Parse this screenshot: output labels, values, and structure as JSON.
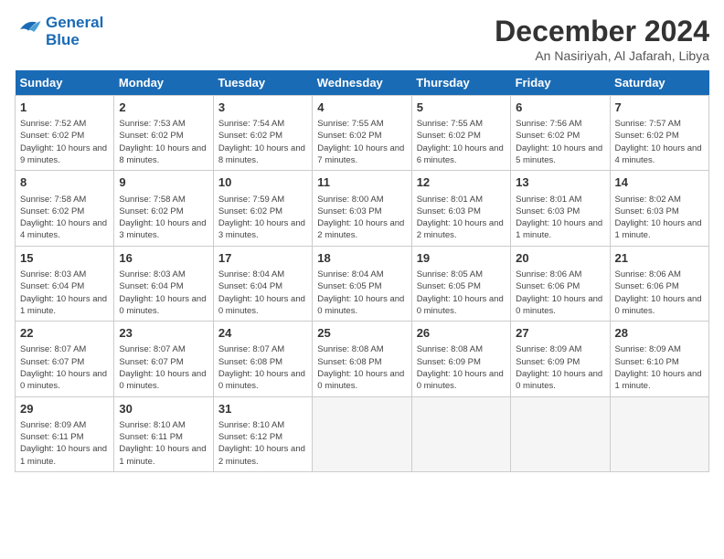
{
  "header": {
    "logo_line1": "General",
    "logo_line2": "Blue",
    "month_title": "December 2024",
    "subtitle": "An Nasiriyah, Al Jafarah, Libya"
  },
  "weekdays": [
    "Sunday",
    "Monday",
    "Tuesday",
    "Wednesday",
    "Thursday",
    "Friday",
    "Saturday"
  ],
  "weeks": [
    [
      {
        "day": 1,
        "sunrise": "7:52 AM",
        "sunset": "6:02 PM",
        "daylight": "10 hours and 9 minutes."
      },
      {
        "day": 2,
        "sunrise": "7:53 AM",
        "sunset": "6:02 PM",
        "daylight": "10 hours and 8 minutes."
      },
      {
        "day": 3,
        "sunrise": "7:54 AM",
        "sunset": "6:02 PM",
        "daylight": "10 hours and 8 minutes."
      },
      {
        "day": 4,
        "sunrise": "7:55 AM",
        "sunset": "6:02 PM",
        "daylight": "10 hours and 7 minutes."
      },
      {
        "day": 5,
        "sunrise": "7:55 AM",
        "sunset": "6:02 PM",
        "daylight": "10 hours and 6 minutes."
      },
      {
        "day": 6,
        "sunrise": "7:56 AM",
        "sunset": "6:02 PM",
        "daylight": "10 hours and 5 minutes."
      },
      {
        "day": 7,
        "sunrise": "7:57 AM",
        "sunset": "6:02 PM",
        "daylight": "10 hours and 4 minutes."
      }
    ],
    [
      {
        "day": 8,
        "sunrise": "7:58 AM",
        "sunset": "6:02 PM",
        "daylight": "10 hours and 4 minutes."
      },
      {
        "day": 9,
        "sunrise": "7:58 AM",
        "sunset": "6:02 PM",
        "daylight": "10 hours and 3 minutes."
      },
      {
        "day": 10,
        "sunrise": "7:59 AM",
        "sunset": "6:02 PM",
        "daylight": "10 hours and 3 minutes."
      },
      {
        "day": 11,
        "sunrise": "8:00 AM",
        "sunset": "6:03 PM",
        "daylight": "10 hours and 2 minutes."
      },
      {
        "day": 12,
        "sunrise": "8:01 AM",
        "sunset": "6:03 PM",
        "daylight": "10 hours and 2 minutes."
      },
      {
        "day": 13,
        "sunrise": "8:01 AM",
        "sunset": "6:03 PM",
        "daylight": "10 hours and 1 minute."
      },
      {
        "day": 14,
        "sunrise": "8:02 AM",
        "sunset": "6:03 PM",
        "daylight": "10 hours and 1 minute."
      }
    ],
    [
      {
        "day": 15,
        "sunrise": "8:03 AM",
        "sunset": "6:04 PM",
        "daylight": "10 hours and 1 minute."
      },
      {
        "day": 16,
        "sunrise": "8:03 AM",
        "sunset": "6:04 PM",
        "daylight": "10 hours and 0 minutes."
      },
      {
        "day": 17,
        "sunrise": "8:04 AM",
        "sunset": "6:04 PM",
        "daylight": "10 hours and 0 minutes."
      },
      {
        "day": 18,
        "sunrise": "8:04 AM",
        "sunset": "6:05 PM",
        "daylight": "10 hours and 0 minutes."
      },
      {
        "day": 19,
        "sunrise": "8:05 AM",
        "sunset": "6:05 PM",
        "daylight": "10 hours and 0 minutes."
      },
      {
        "day": 20,
        "sunrise": "8:06 AM",
        "sunset": "6:06 PM",
        "daylight": "10 hours and 0 minutes."
      },
      {
        "day": 21,
        "sunrise": "8:06 AM",
        "sunset": "6:06 PM",
        "daylight": "10 hours and 0 minutes."
      }
    ],
    [
      {
        "day": 22,
        "sunrise": "8:07 AM",
        "sunset": "6:07 PM",
        "daylight": "10 hours and 0 minutes."
      },
      {
        "day": 23,
        "sunrise": "8:07 AM",
        "sunset": "6:07 PM",
        "daylight": "10 hours and 0 minutes."
      },
      {
        "day": 24,
        "sunrise": "8:07 AM",
        "sunset": "6:08 PM",
        "daylight": "10 hours and 0 minutes."
      },
      {
        "day": 25,
        "sunrise": "8:08 AM",
        "sunset": "6:08 PM",
        "daylight": "10 hours and 0 minutes."
      },
      {
        "day": 26,
        "sunrise": "8:08 AM",
        "sunset": "6:09 PM",
        "daylight": "10 hours and 0 minutes."
      },
      {
        "day": 27,
        "sunrise": "8:09 AM",
        "sunset": "6:09 PM",
        "daylight": "10 hours and 0 minutes."
      },
      {
        "day": 28,
        "sunrise": "8:09 AM",
        "sunset": "6:10 PM",
        "daylight": "10 hours and 1 minute."
      }
    ],
    [
      {
        "day": 29,
        "sunrise": "8:09 AM",
        "sunset": "6:11 PM",
        "daylight": "10 hours and 1 minute."
      },
      {
        "day": 30,
        "sunrise": "8:10 AM",
        "sunset": "6:11 PM",
        "daylight": "10 hours and 1 minute."
      },
      {
        "day": 31,
        "sunrise": "8:10 AM",
        "sunset": "6:12 PM",
        "daylight": "10 hours and 2 minutes."
      },
      null,
      null,
      null,
      null
    ]
  ]
}
